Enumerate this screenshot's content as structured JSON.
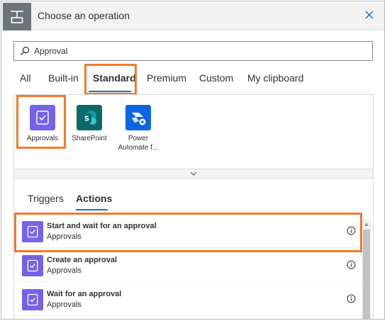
{
  "panel": {
    "title": "Choose an operation",
    "header_icon": "insert-step-icon",
    "close_icon": "close-icon"
  },
  "search": {
    "value": "Approval",
    "icon": "search-icon"
  },
  "tabs": [
    {
      "label": "All",
      "active": false
    },
    {
      "label": "Built-in",
      "active": false
    },
    {
      "label": "Standard",
      "active": true
    },
    {
      "label": "Premium",
      "active": false
    },
    {
      "label": "Custom",
      "active": false
    },
    {
      "label": "My clipboard",
      "active": false
    }
  ],
  "connectors": [
    {
      "label": "Approvals",
      "color": "#7761e8",
      "icon": "approvals-icon"
    },
    {
      "label": "SharePoint",
      "color": "#0b6a66",
      "icon": "sharepoint-icon"
    },
    {
      "label": "Power Automate f...",
      "label_line1": "Power",
      "label_line2": "Automate f...",
      "color": "#0c66e4",
      "icon": "power-automate-icon"
    }
  ],
  "expand_icon": "chevron-down-icon",
  "subtabs": [
    {
      "label": "Triggers",
      "active": false
    },
    {
      "label": "Actions",
      "active": true
    }
  ],
  "actions": [
    {
      "title": "Start and wait for an approval",
      "subtitle": "Approvals"
    },
    {
      "title": "Create an approval",
      "subtitle": "Approvals"
    },
    {
      "title": "Wait for an approval",
      "subtitle": "Approvals"
    }
  ],
  "colors": {
    "accent": "#0078d4",
    "highlight": "#f07b2a",
    "approvals": "#7761e8"
  }
}
